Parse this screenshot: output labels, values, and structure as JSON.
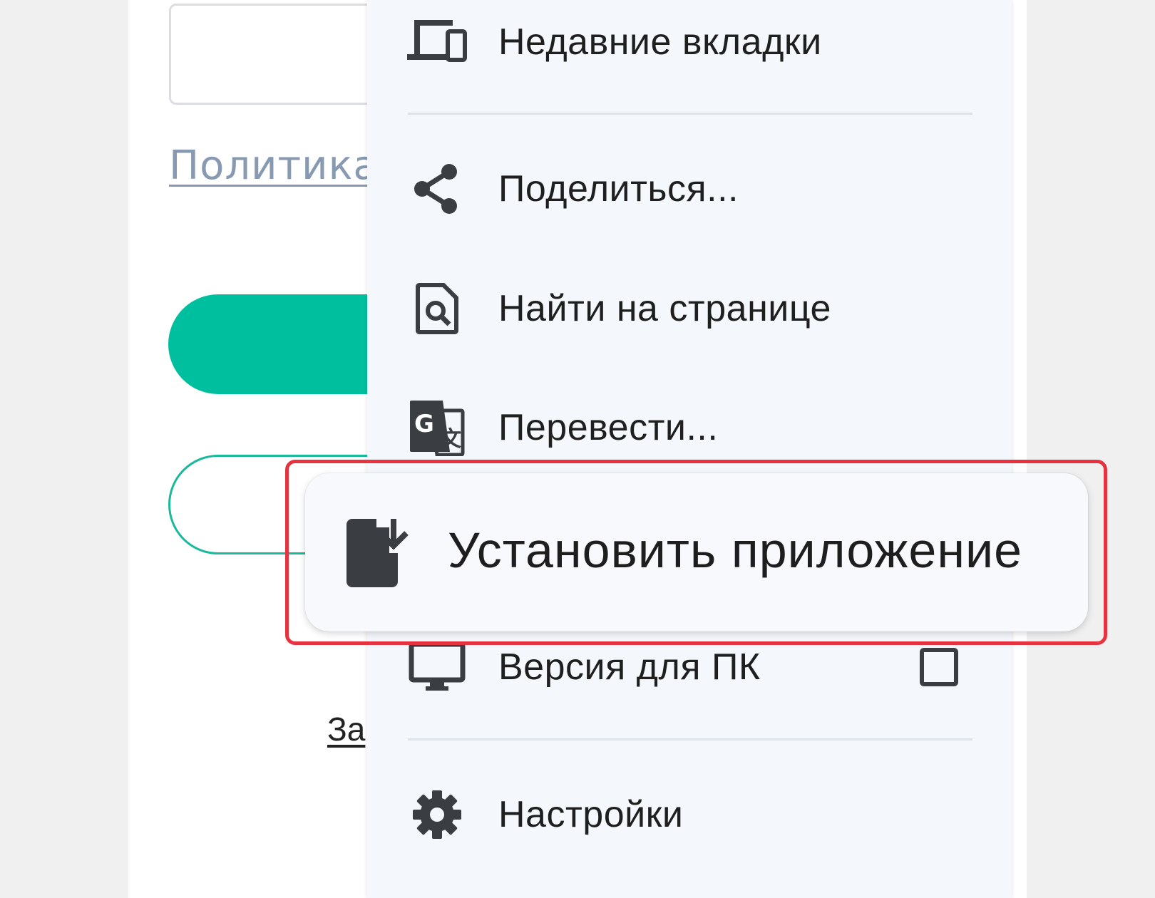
{
  "background_page": {
    "policy_link": "Политика",
    "small_link": "За"
  },
  "menu": {
    "items": [
      {
        "icon": "devices-icon",
        "label": "Недавние вкладки"
      },
      {
        "icon": "share-icon",
        "label": "Поделиться..."
      },
      {
        "icon": "find-in-page-icon",
        "label": "Найти на странице"
      },
      {
        "icon": "translate-icon",
        "label": "Перевести..."
      },
      {
        "icon": "desktop-icon",
        "label": "Версия для ПК",
        "checked": false
      },
      {
        "icon": "settings-icon",
        "label": "Настройки"
      }
    ]
  },
  "highlight": {
    "icon": "install-app-icon",
    "label": "Установить приложение",
    "frame_color": "#e5333f"
  },
  "colors": {
    "accent": "#00bf9f",
    "menu_bg": "#f4f7fc",
    "icon": "#3a3d42"
  }
}
